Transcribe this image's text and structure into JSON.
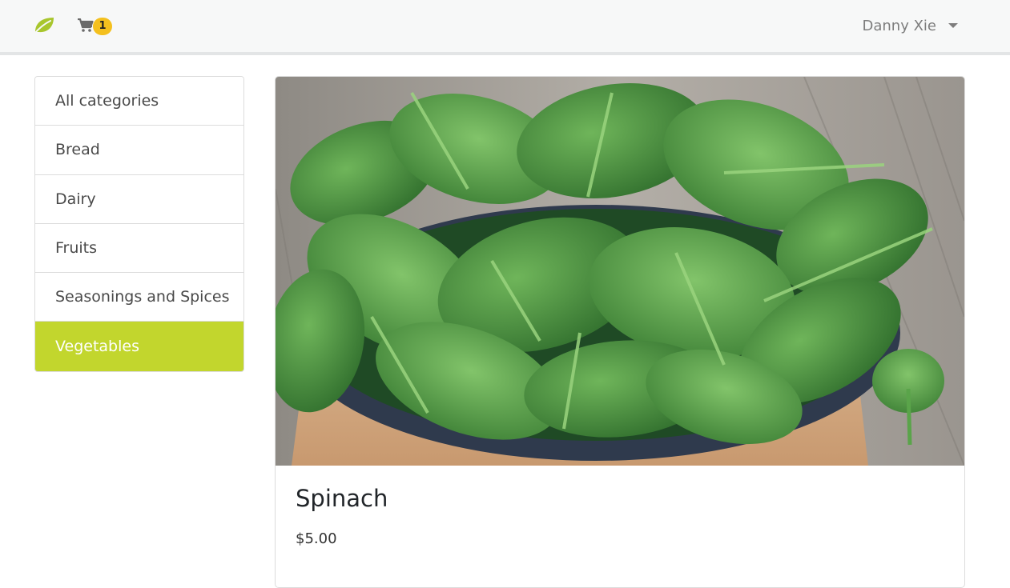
{
  "header": {
    "logo_icon": "leaf-icon",
    "cart_icon": "shopping-cart-icon",
    "cart_count": "1",
    "user_name": "Danny Xie",
    "user_menu_icon": "caret-down-icon"
  },
  "sidebar": {
    "items": [
      {
        "label": "All categories",
        "active": false
      },
      {
        "label": "Bread",
        "active": false
      },
      {
        "label": "Dairy",
        "active": false
      },
      {
        "label": "Fruits",
        "active": false
      },
      {
        "label": "Seasonings and Spices",
        "active": false
      },
      {
        "label": "Vegetables",
        "active": true
      }
    ]
  },
  "product": {
    "name": "Spinach",
    "price": "$5.00"
  },
  "colors": {
    "accent": "#c2d62d",
    "leaf_logo": "#a8c62d",
    "badge": "#f4c01e",
    "navbar_bg": "#f7f8f8"
  }
}
